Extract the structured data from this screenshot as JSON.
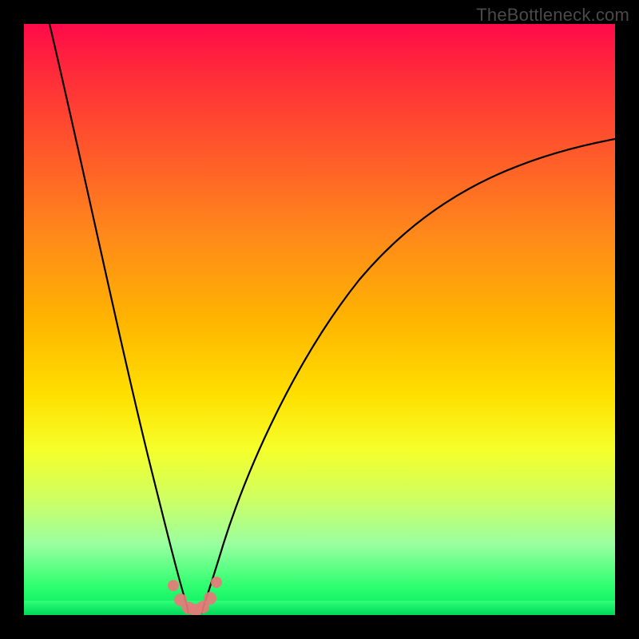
{
  "watermark": "TheBottleneck.com",
  "chart_data": {
    "type": "line",
    "title": "",
    "xlabel": "",
    "ylabel": "",
    "x_range": [
      0,
      100
    ],
    "y_range": [
      0,
      100
    ],
    "series": [
      {
        "name": "left-curve",
        "x": [
          4,
          6,
          8,
          10,
          12,
          14,
          16,
          18,
          20,
          22,
          23.5,
          25,
          26,
          26.8,
          27.5
        ],
        "y": [
          100,
          90,
          80,
          70,
          60,
          50,
          40,
          30,
          22,
          14,
          9,
          5,
          3,
          1.5,
          0
        ]
      },
      {
        "name": "right-curve",
        "x": [
          30,
          31,
          32,
          34,
          36,
          40,
          45,
          50,
          55,
          60,
          65,
          70,
          75,
          80,
          85,
          90,
          95,
          99
        ],
        "y": [
          0,
          1.5,
          3,
          7,
          12,
          22,
          33,
          42,
          49,
          55,
          60,
          64,
          68,
          71.5,
          74.5,
          77,
          79,
          80.5
        ]
      }
    ],
    "markers": {
      "name": "highlight-points",
      "color": "#e77a7a",
      "x": [
        25.2,
        26.5,
        27.8,
        29.0,
        30.2,
        31.4,
        32.5
      ],
      "y": [
        5.0,
        2.5,
        1.2,
        0.8,
        1.3,
        2.8,
        5.5
      ]
    },
    "background_gradient": {
      "top_color": "#ff0a4a",
      "bottom_color": "#00e860",
      "meaning": "red high to green low"
    }
  }
}
